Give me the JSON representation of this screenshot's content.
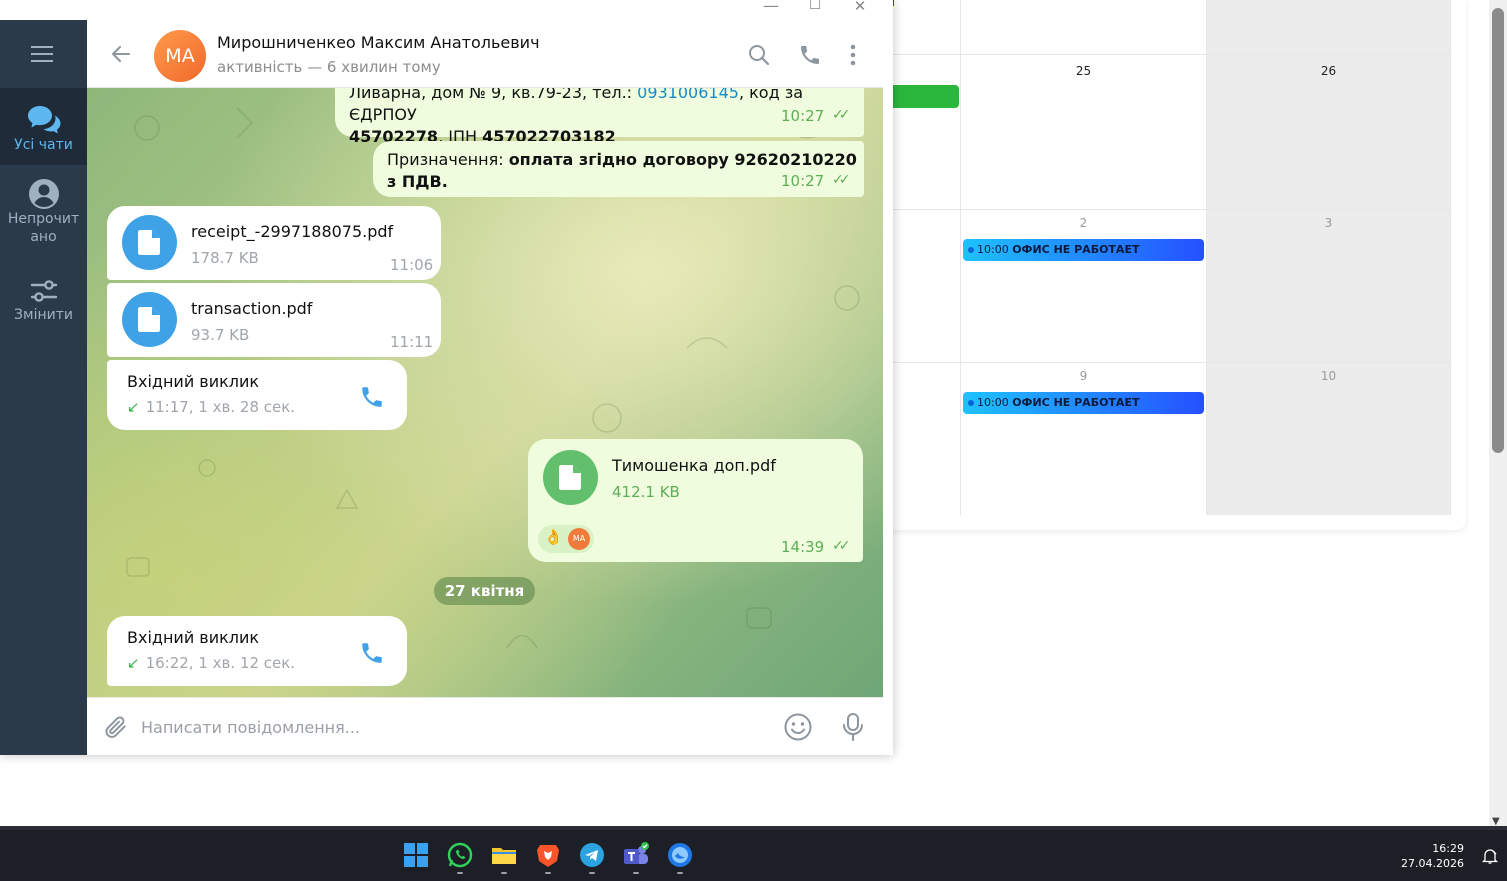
{
  "calendar": {
    "day_numbers": {
      "d25": "25",
      "d26": "26",
      "d2": "2",
      "d3": "3",
      "d9": "9",
      "d10": "10"
    },
    "events": [
      {
        "time": "10:00",
        "title": "ОФИС НЕ РАБОТАЕТ"
      },
      {
        "time": "10:00",
        "title": "ОФИС НЕ РАБОТАЕТ"
      }
    ],
    "accent": "#2bb63c"
  },
  "window_controls": {
    "minimize": "—",
    "maximize": "☐",
    "close": "✕"
  },
  "sidebar": {
    "items": [
      {
        "label": "Усі чати",
        "icon": "chats-icon",
        "active": true
      },
      {
        "label": "Непрочитано",
        "label_line1": "Непрочит",
        "label_line2": "ано",
        "icon": "user-icon"
      },
      {
        "label": "Змінити",
        "icon": "sliders-icon"
      }
    ]
  },
  "header": {
    "avatar_initials": "MA",
    "name": "Мирошниченкео Максим Анатольевич",
    "status": "активність — 6 хвилин тому"
  },
  "messages": {
    "m1": {
      "line1_pre": "Ливарна, дом № 9, кв.79-23, тел.: ",
      "phone": "0931006145",
      "line1_post": ", код за ЄДРПОУ",
      "edrpou": "45702278",
      "ipn_label": ", ІПН ",
      "ipn": "457022703182",
      "time": "10:27"
    },
    "m2": {
      "prefix": "Призначення: ",
      "text": "оплата згідно договору 92620210220 з ПДВ.",
      "time": "10:27"
    },
    "file1": {
      "name": "receipt_-2997188075.pdf",
      "size": "178.7 KB",
      "time": "11:06"
    },
    "file2": {
      "name": "transaction.pdf",
      "size": "93.7 KB",
      "time": "11:11"
    },
    "call1": {
      "title": "Вхідний виклик",
      "meta": "11:17, 1 хв. 28 сек."
    },
    "file3": {
      "name": "Тимошенка доп.pdf",
      "size": "412.1 KB",
      "time": "14:39",
      "reaction_emoji": "👌",
      "reaction_avatar": "MA"
    },
    "date_separator": "27 квітня",
    "call2": {
      "title": "Вхідний виклик",
      "meta": "16:22, 1 хв. 12 сек."
    }
  },
  "composer": {
    "placeholder": "Написати повідомлення..."
  },
  "taskbar": {
    "apps": [
      "windows-start",
      "whatsapp",
      "file-explorer",
      "brave",
      "telegram",
      "teams",
      "web-app"
    ],
    "time": "16:29",
    "date": "27.04.2026"
  }
}
